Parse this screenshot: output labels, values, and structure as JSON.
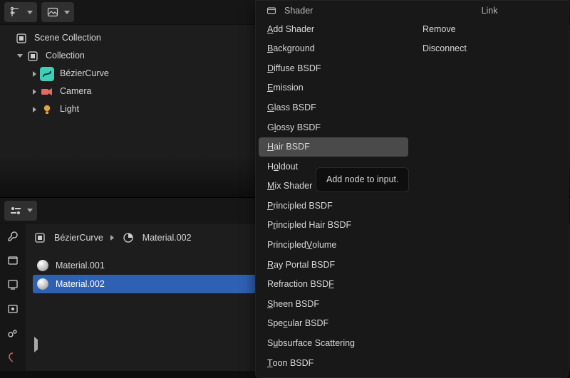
{
  "outliner": {
    "scene_collection": "Scene Collection",
    "collection": "Collection",
    "items": [
      {
        "label": "BézierCurve",
        "icon": "curve-icon",
        "tag_color": "teal"
      },
      {
        "label": "Camera",
        "icon": "camera-icon",
        "tag_color": "teal"
      },
      {
        "label": "Light",
        "icon": "light-icon",
        "tag_color": "teal"
      }
    ]
  },
  "properties": {
    "breadcrumb_object": "BézierCurve",
    "breadcrumb_material": "Material.002",
    "materials": [
      {
        "name": "Material.001",
        "selected": false
      },
      {
        "name": "Material.002",
        "selected": true
      }
    ]
  },
  "menu": {
    "column1_header": "Shader",
    "column1_items": [
      {
        "label_pre": "",
        "hot": "A",
        "label_post": "dd Shader"
      },
      {
        "label_pre": "",
        "hot": "B",
        "label_post": "ackground"
      },
      {
        "label_pre": "",
        "hot": "D",
        "label_post": "iffuse BSDF"
      },
      {
        "label_pre": "",
        "hot": "E",
        "label_post": "mission"
      },
      {
        "label_pre": "",
        "hot": "G",
        "label_post": "lass BSDF"
      },
      {
        "label_pre": "G",
        "hot": "l",
        "label_post": "ossy BSDF"
      },
      {
        "label_pre": "",
        "hot": "H",
        "label_post": "air BSDF",
        "hovered": true
      },
      {
        "label_pre": "H",
        "hot": "o",
        "label_post": "ldout"
      },
      {
        "label_pre": "",
        "hot": "M",
        "label_post": "ix Shader"
      },
      {
        "label_pre": "",
        "hot": "P",
        "label_post": "rincipled BSDF"
      },
      {
        "label_pre": "P",
        "hot": "r",
        "label_post": "incipled Hair BSDF"
      },
      {
        "label_pre": "Principled ",
        "hot": "V",
        "label_post": "olume"
      },
      {
        "label_pre": "",
        "hot": "R",
        "label_post": "ay Portal BSDF"
      },
      {
        "label_pre": "Refraction BSD",
        "hot": "F",
        "label_post": ""
      },
      {
        "label_pre": "",
        "hot": "S",
        "label_post": "heen BSDF"
      },
      {
        "label_pre": "Spe",
        "hot": "c",
        "label_post": "ular BSDF"
      },
      {
        "label_pre": "S",
        "hot": "u",
        "label_post": "bsurface Scattering"
      },
      {
        "label_pre": "",
        "hot": "T",
        "label_post": "oon BSDF"
      }
    ],
    "column2_header": "Link",
    "column2_items": [
      {
        "label": "Remove"
      },
      {
        "label": "Disconnect"
      }
    ]
  },
  "tooltip": "Add node to input."
}
